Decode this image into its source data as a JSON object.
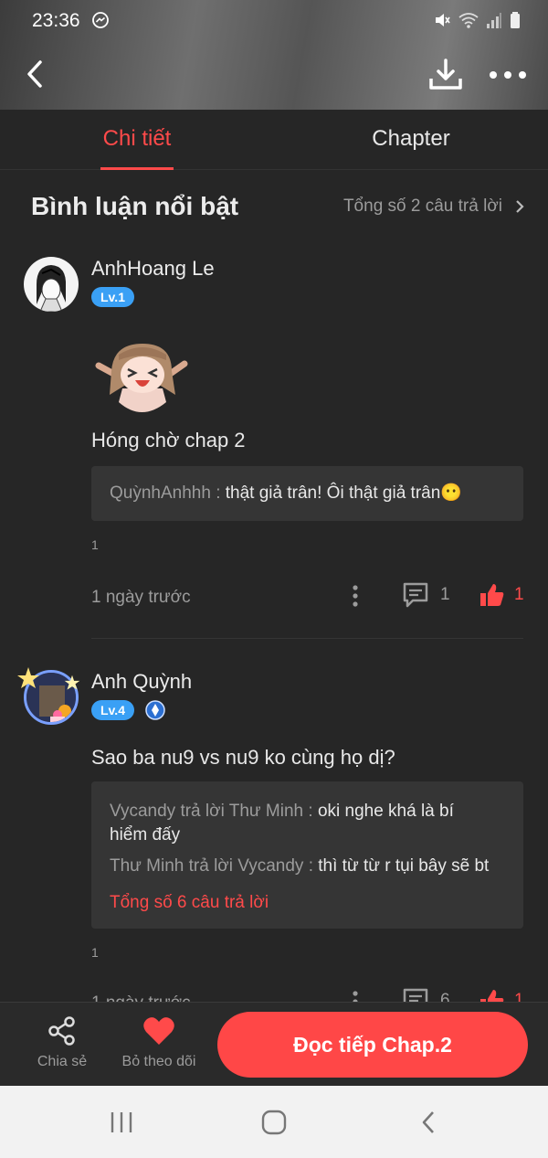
{
  "status": {
    "time": "23:36"
  },
  "tabs": [
    {
      "label": "Chi tiết",
      "active": true
    },
    {
      "label": "Chapter",
      "active": false
    }
  ],
  "section": {
    "title": "Bình luận nổi bật",
    "total_replies": "Tổng số 2 câu trả lời"
  },
  "comments": [
    {
      "username": "AnhHoang Le",
      "level": "Lv.1",
      "text": "Hóng chờ chap 2",
      "replies": [
        {
          "name": "QuỳnhAnhhh : ",
          "text": "thật giả trân! Ôi thật giả trân😶"
        }
      ],
      "index_num": "1",
      "time": "1 ngày trước",
      "comment_count": "1",
      "like_count": "1"
    },
    {
      "username": "Anh Quỳnh",
      "level": "Lv.4",
      "text": "Sao ba nu9 vs nu9 ko cùng họ dị?",
      "replies": [
        {
          "name": "Vycandy trả lời Thư Minh : ",
          "text": "oki nghe khá là bí hiểm đấy"
        },
        {
          "name": "Thư Minh trả lời Vycandy : ",
          "text": "thì từ từ r tụi bây sẽ bt"
        }
      ],
      "total_replies": "Tổng số 6 câu trả lời",
      "index_num": "1",
      "time": "1 ngày trước",
      "comment_count": "6",
      "like_count": "1"
    }
  ],
  "bottom": {
    "share": "Chia sẻ",
    "unfollow": "Bỏ theo dõi",
    "continue": "Đọc tiếp Chap.2"
  },
  "colors": {
    "accent": "#ff4a4a",
    "level": "#3aa0f5",
    "background": "#262626"
  }
}
